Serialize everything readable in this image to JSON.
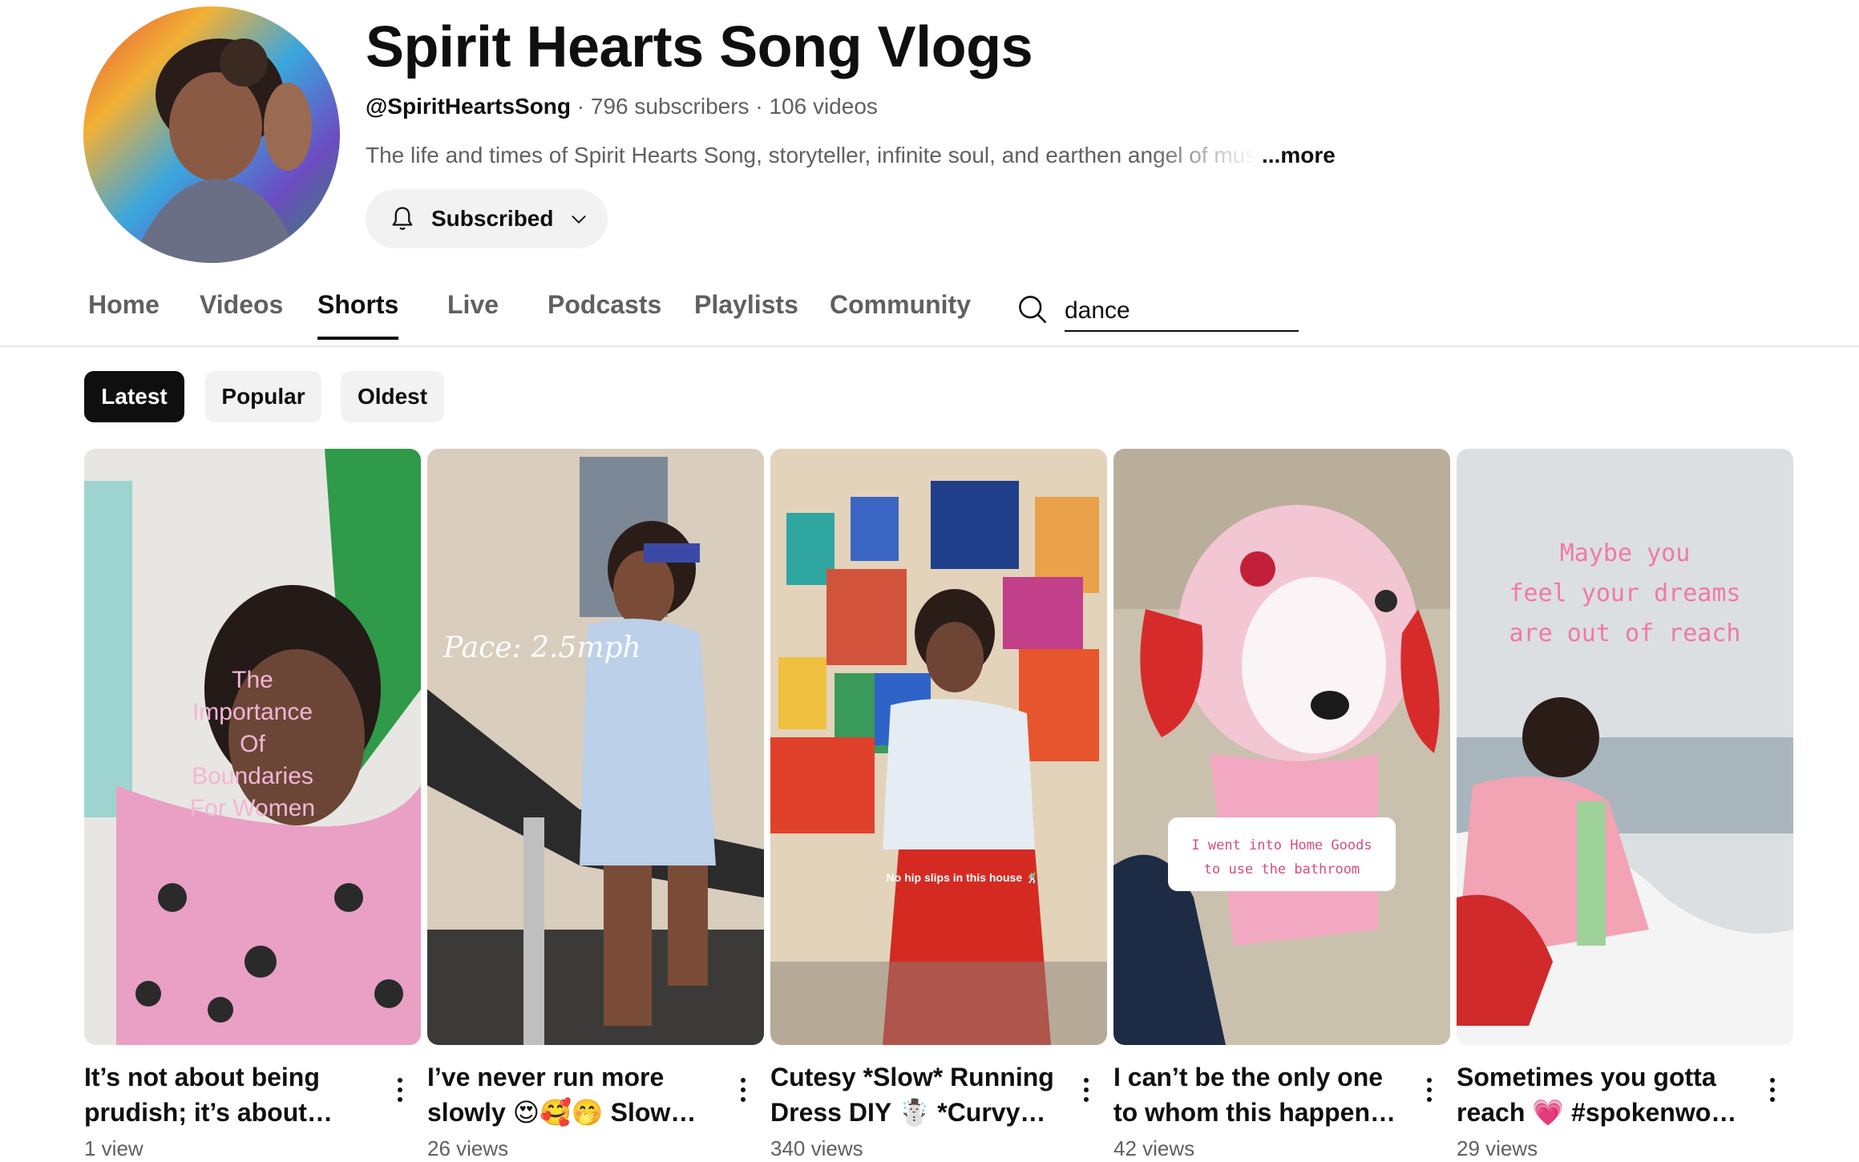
{
  "channel": {
    "name": "Spirit Hearts Song Vlogs",
    "handle": "@SpiritHeartsSong",
    "separator": "·",
    "subscribers": "796 subscribers",
    "videos": "106 videos",
    "description": "The life and times of Spirit Hearts Song, storyteller, infinite soul, and earthen angel of music",
    "more_label": "...more",
    "avatar_icon": "channel-avatar"
  },
  "subscribe": {
    "label": "Subscribed",
    "icon": "bell-icon",
    "dropdown_icon": "chevron-down-icon"
  },
  "tabs": [
    "Home",
    "Videos",
    "Shorts",
    "Live",
    "Podcasts",
    "Playlists",
    "Community"
  ],
  "active_tab": "Shorts",
  "search": {
    "icon": "search-icon",
    "value": "dance"
  },
  "chips": [
    "Latest",
    "Popular",
    "Oldest"
  ],
  "active_chip": "Latest",
  "shorts": [
    {
      "title": "It’s not about being prudish; it’s about being clear",
      "views": "1 view",
      "overlay": "The Importance Of Boundaries For Women"
    },
    {
      "title": "I’ve never run more slowly 😍🥰🤭 Slow Running",
      "views": "26 views",
      "overlay": "Pace: 2.5mph"
    },
    {
      "title": "Cutesy *Slow* Running Dress DIY ☃️ *Curvy Girl*",
      "views": "340 views",
      "overlay": "No hip slips in this house 🕺"
    },
    {
      "title": "I can’t be the only one to whom this happens! #homegoods",
      "views": "42 views",
      "overlay": "I went into Home Goods to use the bathroom"
    },
    {
      "title": "Sometimes you gotta reach 💗 #spokenword poetry",
      "views": "29 views",
      "overlay": "Maybe you feel your dreams are out of reach"
    }
  ],
  "colors": {
    "text_primary": "#0f0f0f",
    "text_secondary": "#606060",
    "chip_bg": "#f2f2f2",
    "active_chip_bg": "#0f0f0f"
  }
}
